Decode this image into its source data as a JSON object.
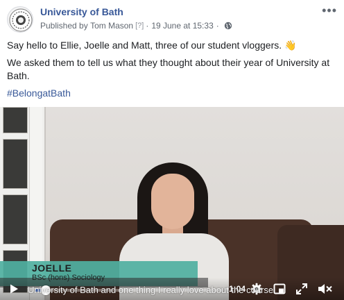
{
  "header": {
    "page_name": "University of Bath",
    "published_prefix": "Published by",
    "publisher": "Tom Mason",
    "help_marker": "[?]",
    "separator": "·",
    "date": "19 June at 15:33",
    "audience_icon": "globe-icon",
    "more_label": "•••"
  },
  "post": {
    "line1": "Say hello to Ellie, Joelle and Matt, three of our student vloggers. 👋",
    "line2": "We asked them to tell us what they thought about their year of University at Bath.",
    "hashtag": "#BelongatBath"
  },
  "video": {
    "caption_name": "JOELLE",
    "caption_degree": "BSc (hons) Sociology",
    "subtitle": "University of Bath and one thing I really love about the course",
    "time_remaining": "-1:04",
    "progress_fraction": 0.06,
    "controls": {
      "play_icon": "play-icon",
      "settings_icon": "gear-icon",
      "hd_icon": "picture-in-picture-icon",
      "expand_icon": "expand-icon",
      "mute_icon": "speaker-muted-icon"
    }
  },
  "colors": {
    "link": "#385898",
    "meta": "#606770",
    "caption_band": "#4fb0a1",
    "progress": "#4267b2"
  }
}
